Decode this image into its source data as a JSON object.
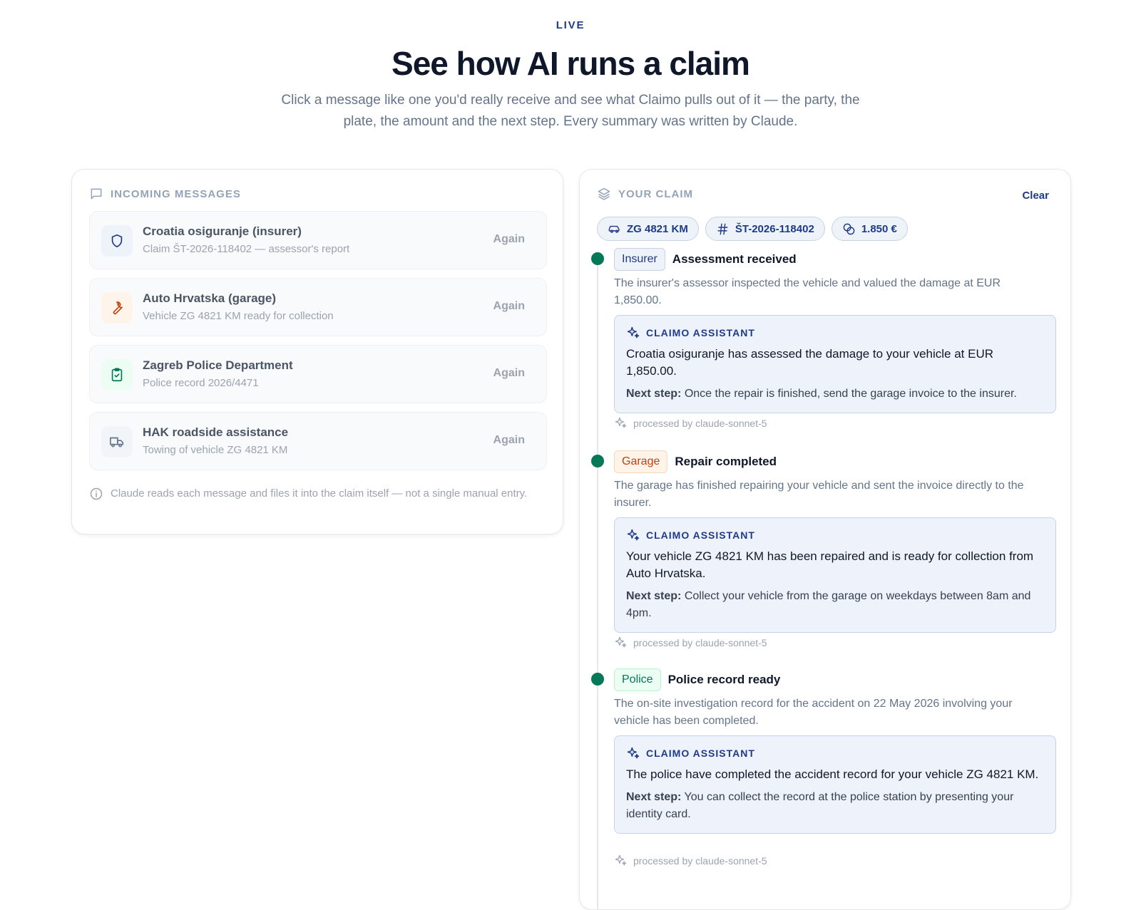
{
  "hero": {
    "eyebrow": "LIVE",
    "title": "See how AI runs a claim",
    "subtitle": "Click a message like one you'd really receive and see what Claimo pulls out of it — the party, the plate, the amount and the next step. Every summary was written by Claude."
  },
  "incoming": {
    "heading": "INCOMING MESSAGES",
    "messages": [
      {
        "name": "Croatia osiguranje (insurer)",
        "desc": "Claim ŠT-2026-118402 — assessor's report",
        "action": "Again",
        "icon": "shield-icon",
        "color": "#1e3a8a"
      },
      {
        "name": "Auto Hrvatska (garage)",
        "desc": "Vehicle ZG 4821 KM ready for collection",
        "action": "Again",
        "icon": "wrench-icon",
        "color": "#c2410c"
      },
      {
        "name": "Zagreb Police Department",
        "desc": "Police record 2026/4471",
        "action": "Again",
        "icon": "clipboard-check-icon",
        "color": "#047857"
      },
      {
        "name": "HAK roadside assistance",
        "desc": "Towing of vehicle ZG 4821 KM",
        "action": "Again",
        "icon": "truck-icon",
        "color": "#64748b"
      }
    ],
    "note": "Claude reads each message and files it into the claim itself — not a single manual entry."
  },
  "claim": {
    "heading": "YOUR CLAIM",
    "clear_label": "Clear",
    "chips": [
      {
        "label": "ZG 4821 KM",
        "icon": "car-icon"
      },
      {
        "label": "ŠT-2026-118402",
        "icon": "hash-icon"
      },
      {
        "label": "1.850 €",
        "icon": "coins-icon"
      }
    ],
    "events": [
      {
        "tag": "Insurer",
        "title": "Assessment received",
        "text": "The insurer's assessor inspected the vehicle and valued the damage at EUR 1,850.00.",
        "assistant_label": "CLAIMO ASSISTANT",
        "summary": "Croatia osiguranje has assessed the damage to your vehicle at EUR 1,850.00.",
        "next_label": "Next step:",
        "next": "Once the repair is finished, send the garage invoice to the insurer.",
        "processed": "processed by claude-sonnet-5"
      },
      {
        "tag": "Garage",
        "title": "Repair completed",
        "text": "The garage has finished repairing your vehicle and sent the invoice directly to the insurer.",
        "assistant_label": "CLAIMO ASSISTANT",
        "summary": "Your vehicle ZG 4821 KM has been repaired and is ready for collection from Auto Hrvatska.",
        "next_label": "Next step:",
        "next": "Collect your vehicle from the garage on weekdays between 8am and 4pm.",
        "processed": "processed by claude-sonnet-5"
      },
      {
        "tag": "Police",
        "title": "Police record ready",
        "text": "The on-site investigation record for the accident on 22 May 2026 involving your vehicle has been completed.",
        "assistant_label": "CLAIMO ASSISTANT",
        "summary": "The police have completed the accident record for your vehicle ZG 4821 KM.",
        "next_label": "Next step:",
        "next": "You can collect the record at the police station by presenting your identity card.",
        "processed": "processed by claude-sonnet-5"
      }
    ]
  }
}
